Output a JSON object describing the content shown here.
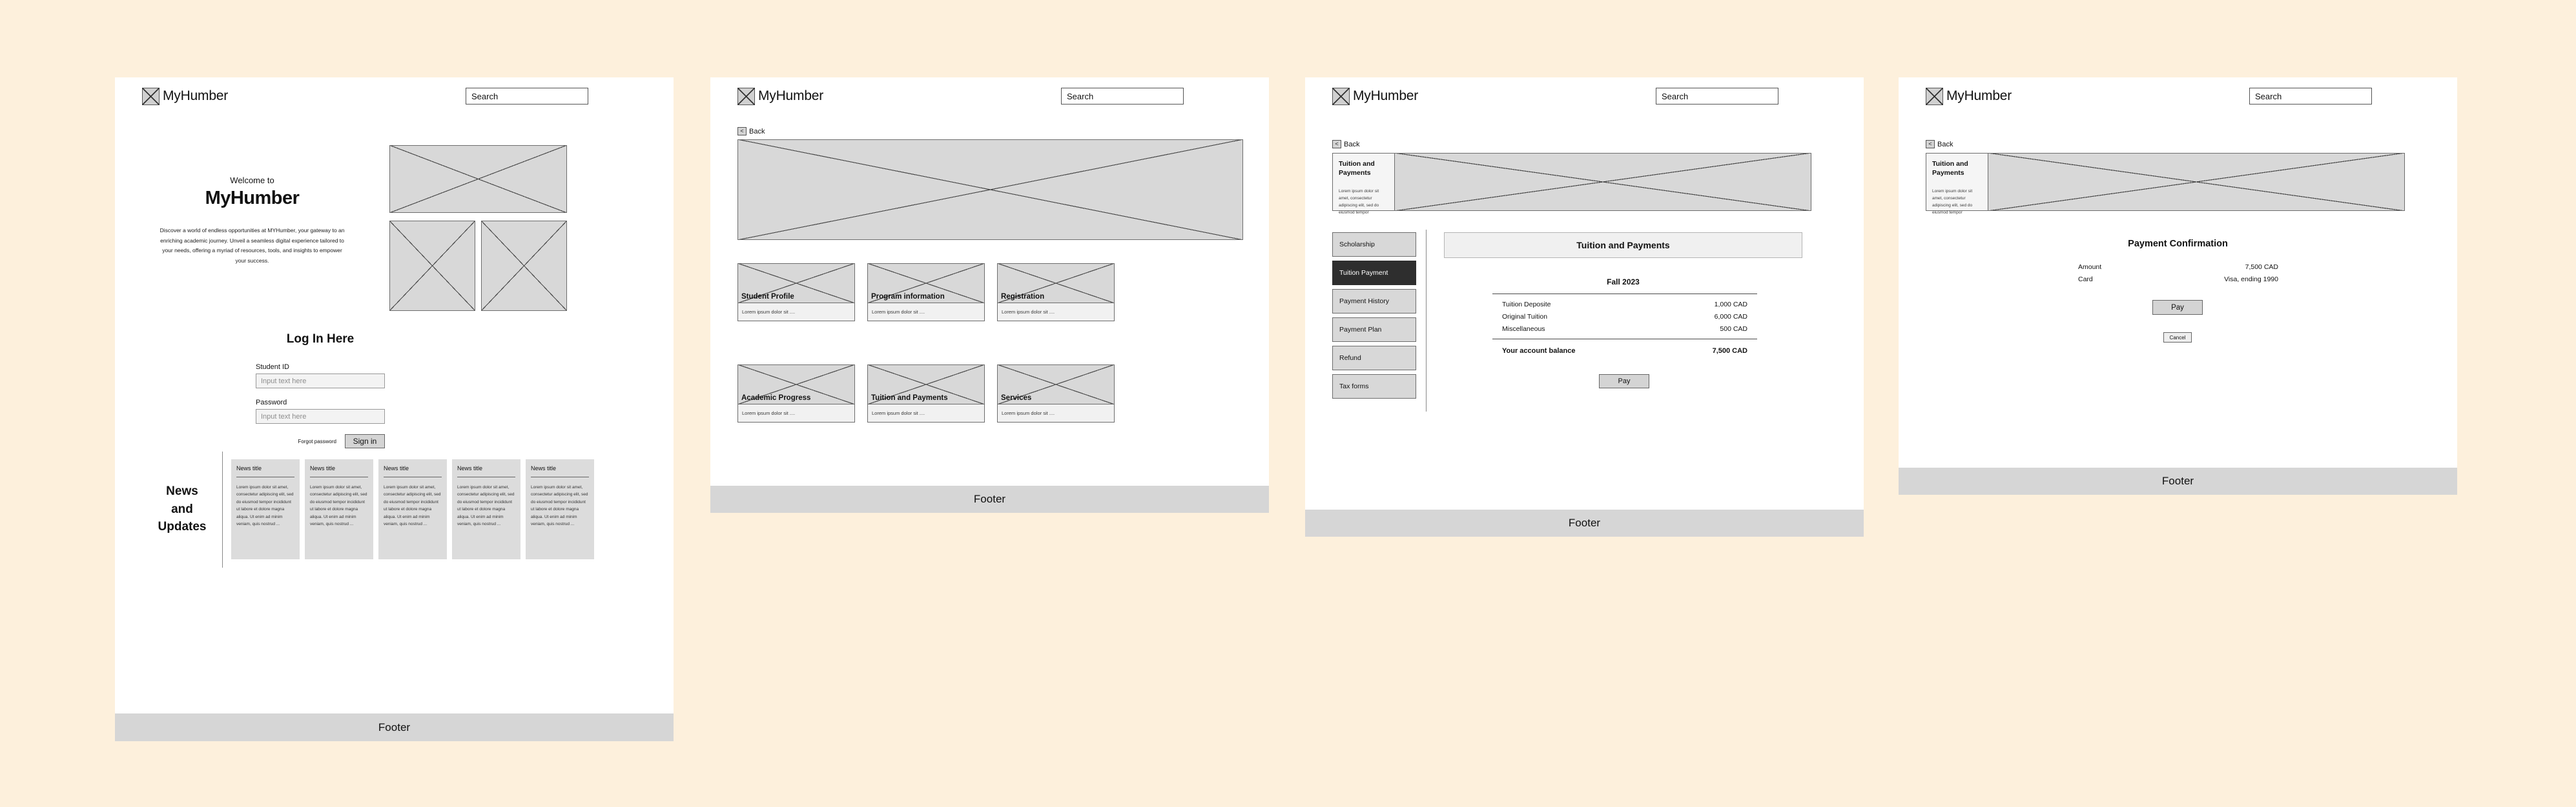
{
  "background_color": "#fdf0dc",
  "brand": {
    "name": "MyHumber",
    "logo_icon": "logo-placeholder-icon"
  },
  "search": {
    "placeholder": "Search",
    "label": "Search",
    "icon": "search-icon"
  },
  "back": {
    "label": "Back",
    "icon": "chevron-left-icon"
  },
  "footer": {
    "label": "Footer"
  },
  "screen1": {
    "welcome_small": "Welcome to",
    "welcome_large": "MyHumber",
    "intro": "Discover a world of endless opportunities at MYHumber, your gateway to an enriching academic journey. Unveil a seamless digital experience tailored to your needs, offering a myriad of resources, tools, and insights to empower your success.",
    "login": {
      "title": "Log In Here",
      "student_id_label": "Student ID",
      "student_id_placeholder": "Input text here",
      "student_id_value": "",
      "password_label": "Password",
      "password_placeholder": "Input text here",
      "password_value": "",
      "forgot_label": "Forgot password",
      "signin_label": "Sign in"
    },
    "news": {
      "section_label": "News\nand\nUpdates",
      "section_label_lines": [
        "News",
        "and",
        "Updates"
      ],
      "cards": [
        {
          "title": "News title",
          "body": "Lorem ipsum dolor sit amet, consectetur adipiscing elit, sed do eiusmod tempor incididunt ut labore et dolore magna aliqua. Ut enim ad minim veniam, quis nostrud ..."
        },
        {
          "title": "News title",
          "body": "Lorem ipsum dolor sit amet, consectetur adipiscing elit, sed do eiusmod tempor incididunt ut labore et dolore magna aliqua. Ut enim ad minim veniam, quis nostrud ..."
        },
        {
          "title": "News title",
          "body": "Lorem ipsum dolor sit amet, consectetur adipiscing elit, sed do eiusmod tempor incididunt ut labore et dolore magna aliqua. Ut enim ad minim veniam, quis nostrud ..."
        },
        {
          "title": "News title",
          "body": "Lorem ipsum dolor sit amet, consectetur adipiscing elit, sed do eiusmod tempor incididunt ut labore et dolore magna aliqua. Ut enim ad minim veniam, quis nostrud ..."
        },
        {
          "title": "News title",
          "body": "Lorem ipsum dolor sit amet, consectetur adipiscing elit, sed do eiusmod tempor incididunt ut labore et dolore magna aliqua. Ut enim ad minim veniam, quis nostrud ..."
        }
      ]
    }
  },
  "screen2": {
    "tiles": [
      {
        "title": "Student Profile",
        "desc": "Lorem ipsum dolor sit ...."
      },
      {
        "title": "Program information",
        "desc": "Lorem ipsum dolor sit ...."
      },
      {
        "title": "Registration",
        "desc": "Lorem ipsum dolor sit ...."
      },
      {
        "title": "Academic Progress",
        "desc": "Lorem ipsum dolor sit ...."
      },
      {
        "title": "Tuition and Payments",
        "desc": "Lorem ipsum dolor sit ...."
      },
      {
        "title": "Services",
        "desc": "Lorem ipsum dolor sit ...."
      }
    ]
  },
  "screen3": {
    "hero": {
      "title": "Tuition and Payments",
      "body": "Lorem ipsum dolor sit amet, consectetur adipiscing elit, sed do eiusmod tempor"
    },
    "sidenav": [
      {
        "label": "Scholarship",
        "active": false
      },
      {
        "label": "Tuition Payment",
        "active": true
      },
      {
        "label": "Payment History",
        "active": false
      },
      {
        "label": "Payment Plan",
        "active": false
      },
      {
        "label": "Refund",
        "active": false
      },
      {
        "label": "Tax forms",
        "active": false
      }
    ],
    "section_title": "Tuition and Payments",
    "term": "Fall 2023",
    "line_items": [
      {
        "label": "Tuition Deposite",
        "amount": "1,000 CAD"
      },
      {
        "label": "Original Tuition",
        "amount": "6,000 CAD"
      },
      {
        "label": "Miscellaneous",
        "amount": "500 CAD"
      }
    ],
    "balance": {
      "label": "Your account balance",
      "amount": "7,500 CAD"
    },
    "pay_label": "Pay"
  },
  "screen4": {
    "hero": {
      "title": "Tuition and Payments",
      "body": "Lorem ipsum dolor sit amet, consectetur adipiscing elit, sed do eiusmod tempor"
    },
    "confirmation_title": "Payment Confirmation",
    "rows": [
      {
        "label": "Amount",
        "value": "7,500 CAD"
      },
      {
        "label": "Card",
        "value": "Visa, ending 1990"
      }
    ],
    "pay_label": "Pay",
    "cancel_label": "Cancel"
  }
}
